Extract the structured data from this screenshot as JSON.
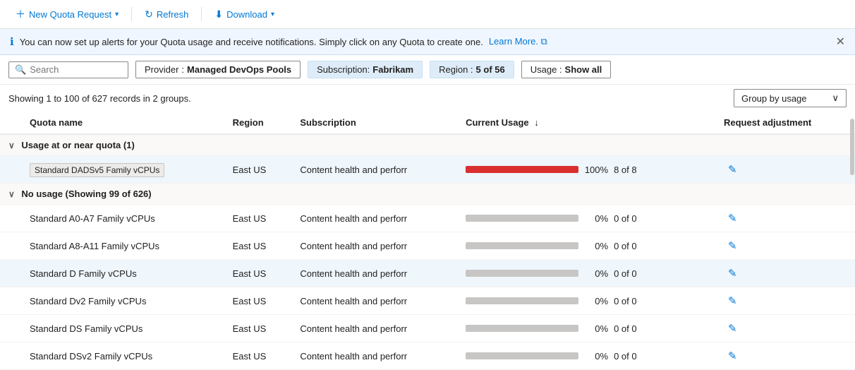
{
  "toolbar": {
    "new_quota_label": "New Quota Request",
    "new_quota_chevron": "▾",
    "refresh_label": "Refresh",
    "download_label": "Download",
    "download_chevron": "▾"
  },
  "banner": {
    "message": "You can now set up alerts for your Quota usage and receive notifications. Simply click on any Quota to create one.",
    "learn_more": "Learn More.",
    "learn_more_icon": "⧉"
  },
  "filters": {
    "search_placeholder": "Search",
    "provider_label": "Provider",
    "provider_value": "Managed DevOps Pools",
    "subscription_label": "Subscription:",
    "subscription_value": "Fabrikam",
    "region_label": "Region :",
    "region_value": "5 of 56",
    "usage_label": "Usage :",
    "usage_value": "Show all"
  },
  "summary": {
    "text": "Showing 1 to 100 of 627 records in",
    "groups": "2 groups.",
    "group_dropdown_label": "Group by usage",
    "group_dropdown_icon": "▾"
  },
  "table": {
    "columns": [
      {
        "id": "name",
        "label": "Quota name",
        "sortable": false
      },
      {
        "id": "region",
        "label": "Region",
        "sortable": false
      },
      {
        "id": "subscription",
        "label": "Subscription",
        "sortable": false
      },
      {
        "id": "usage",
        "label": "Current Usage",
        "sortable": true,
        "sort_icon": "↓"
      },
      {
        "id": "adjustment",
        "label": "Request adjustment",
        "sortable": false
      }
    ],
    "groups": [
      {
        "id": "near-quota",
        "label": "Usage at or near quota (1)",
        "collapsed": false,
        "rows": [
          {
            "name": "Standard DADSv5 Family vCPUs",
            "highlighted": true,
            "chip": true,
            "region": "East US",
            "subscription": "Content health and perforr",
            "usage_pct": 100,
            "usage_pct_label": "100%",
            "usage_count": "8 of 8",
            "bar_color": "#d92f2f"
          }
        ]
      },
      {
        "id": "no-usage",
        "label": "No usage (Showing 99 of 626)",
        "collapsed": false,
        "rows": [
          {
            "name": "Standard A0-A7 Family vCPUs",
            "highlighted": false,
            "chip": false,
            "region": "East US",
            "subscription": "Content health and perforr",
            "usage_pct": 0,
            "usage_pct_label": "0%",
            "usage_count": "0 of 0",
            "bar_color": "#c8c6c4"
          },
          {
            "name": "Standard A8-A11 Family vCPUs",
            "highlighted": false,
            "chip": false,
            "region": "East US",
            "subscription": "Content health and perforr",
            "usage_pct": 0,
            "usage_pct_label": "0%",
            "usage_count": "0 of 0",
            "bar_color": "#c8c6c4"
          },
          {
            "name": "Standard D Family vCPUs",
            "highlighted": true,
            "chip": false,
            "region": "East US",
            "subscription": "Content health and perforr",
            "usage_pct": 0,
            "usage_pct_label": "0%",
            "usage_count": "0 of 0",
            "bar_color": "#c8c6c4"
          },
          {
            "name": "Standard Dv2 Family vCPUs",
            "highlighted": false,
            "chip": false,
            "region": "East US",
            "subscription": "Content health and perforr",
            "usage_pct": 0,
            "usage_pct_label": "0%",
            "usage_count": "0 of 0",
            "bar_color": "#c8c6c4"
          },
          {
            "name": "Standard DS Family vCPUs",
            "highlighted": false,
            "chip": false,
            "region": "East US",
            "subscription": "Content health and perforr",
            "usage_pct": 0,
            "usage_pct_label": "0%",
            "usage_count": "0 of 0",
            "bar_color": "#c8c6c4"
          },
          {
            "name": "Standard DSv2 Family vCPUs",
            "highlighted": false,
            "chip": false,
            "region": "East US",
            "subscription": "Content health and perforr",
            "usage_pct": 0,
            "usage_pct_label": "0%",
            "usage_count": "0 of 0",
            "bar_color": "#c8c6c4"
          }
        ]
      }
    ]
  },
  "icons": {
    "new": "＋",
    "refresh": "↻",
    "download": "⬇",
    "search": "🔍",
    "info": "ℹ",
    "close": "✕",
    "edit": "✎",
    "collapse": "∨",
    "chevron_down": "∨"
  }
}
